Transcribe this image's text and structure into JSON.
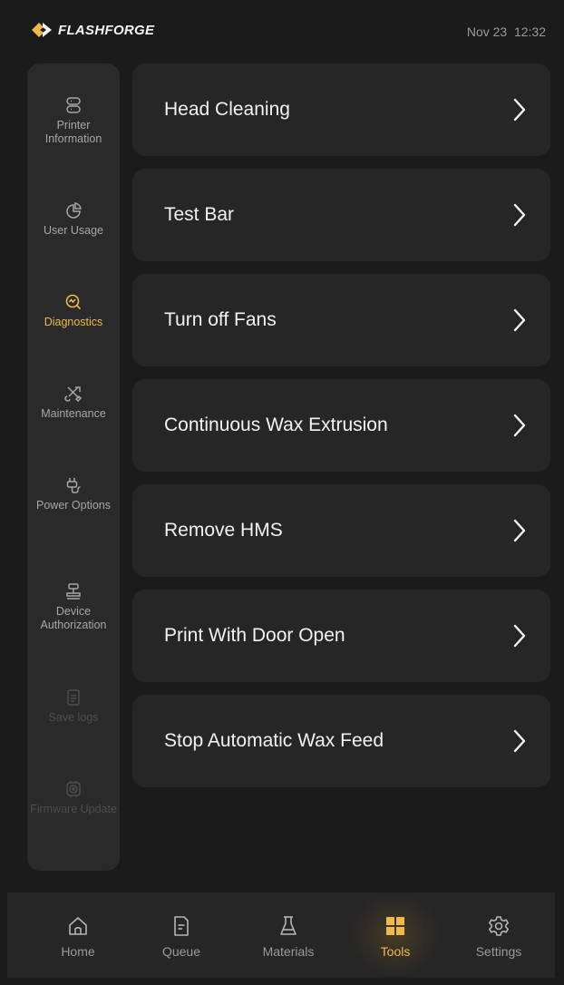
{
  "status": {
    "brand": "FLASHFORGE",
    "datetime": "Nov 23  12:32"
  },
  "sidebar": {
    "items": [
      {
        "label": "Printer Information",
        "icon": "server-icon",
        "state": "normal"
      },
      {
        "label": "User Usage",
        "icon": "pie-chart-icon",
        "state": "normal"
      },
      {
        "label": "Diagnostics",
        "icon": "diagnostics-icon",
        "state": "active"
      },
      {
        "label": "Maintenance",
        "icon": "tools-icon",
        "state": "normal"
      },
      {
        "label": "Power Options",
        "icon": "plug-icon",
        "state": "normal"
      },
      {
        "label": "Device Authorization",
        "icon": "authorization-icon",
        "state": "normal"
      },
      {
        "label": "Save logs",
        "icon": "document-icon",
        "state": "disabled"
      },
      {
        "label": "Firmware Update",
        "icon": "upload-chip-icon",
        "state": "disabled"
      }
    ]
  },
  "menu": {
    "items": [
      {
        "label": "Head Cleaning"
      },
      {
        "label": "Test Bar"
      },
      {
        "label": "Turn off Fans"
      },
      {
        "label": "Continuous Wax Extrusion"
      },
      {
        "label": "Remove HMS"
      },
      {
        "label": "Print With Door Open"
      },
      {
        "label": "Stop Automatic Wax Feed"
      }
    ]
  },
  "nav": {
    "items": [
      {
        "label": "Home",
        "icon": "home-icon"
      },
      {
        "label": "Queue",
        "icon": "queue-icon"
      },
      {
        "label": "Materials",
        "icon": "flask-icon"
      },
      {
        "label": "Tools",
        "icon": "grid-icon",
        "active": true
      },
      {
        "label": "Settings",
        "icon": "gear-icon"
      }
    ]
  },
  "colors": {
    "accent": "#f0b94f",
    "background": "#1b1b1b",
    "card": "#262626",
    "sidebar": "#2a2a2a"
  }
}
